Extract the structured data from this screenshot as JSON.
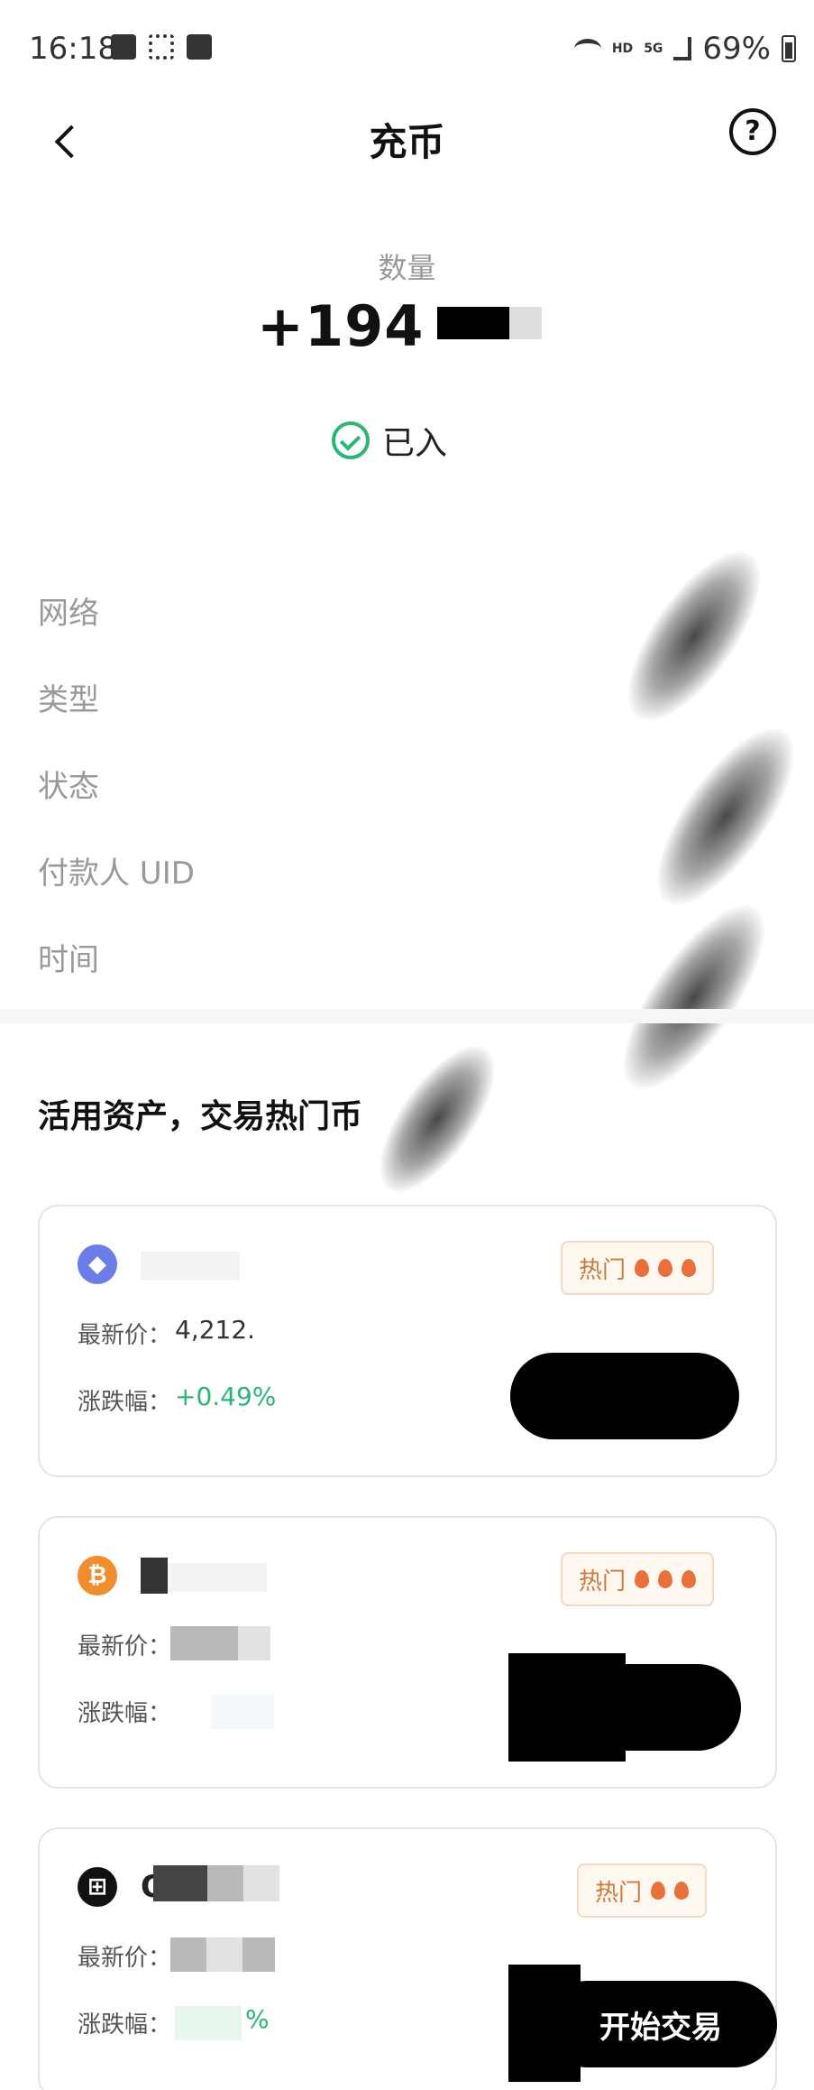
{
  "status_bar": {
    "time": "16:18",
    "hd_label": "HD",
    "net_label": "5G",
    "battery": "69%"
  },
  "header": {
    "title": "充币",
    "help_symbol": "?"
  },
  "amount": {
    "label": "数量",
    "value": "+194"
  },
  "status": {
    "text": "已入"
  },
  "details": [
    {
      "label": "网络"
    },
    {
      "label": "类型"
    },
    {
      "label": "状态"
    },
    {
      "label": "付款人 UID"
    },
    {
      "label": "时间"
    }
  ],
  "section": {
    "title": "活用资产，交易热门币"
  },
  "cards": [
    {
      "icon": "ethereum-icon",
      "icon_color": "#6b7ee8",
      "name": "",
      "hot_label": "热门",
      "flames": 3,
      "latest_label": "最新价：",
      "latest_value": "4,212.",
      "change_label": "涨跌幅：",
      "change_value": "+0.49%",
      "button_label": ""
    },
    {
      "icon": "bitcoin-icon",
      "icon_color": "#f08d2e",
      "name": "B",
      "hot_label": "热门",
      "flames": 3,
      "latest_label": "最新价：",
      "latest_value": "",
      "change_label": "涨跌幅：",
      "change_value": "",
      "button_label": ""
    },
    {
      "icon": "okb-icon",
      "icon_color": "#111111",
      "name": "O",
      "hot_label": "热门",
      "flames": 2,
      "latest_label": "最新价：",
      "latest_value": "",
      "change_label": "涨跌幅：",
      "change_value": "%",
      "button_label": "开始交易"
    }
  ]
}
